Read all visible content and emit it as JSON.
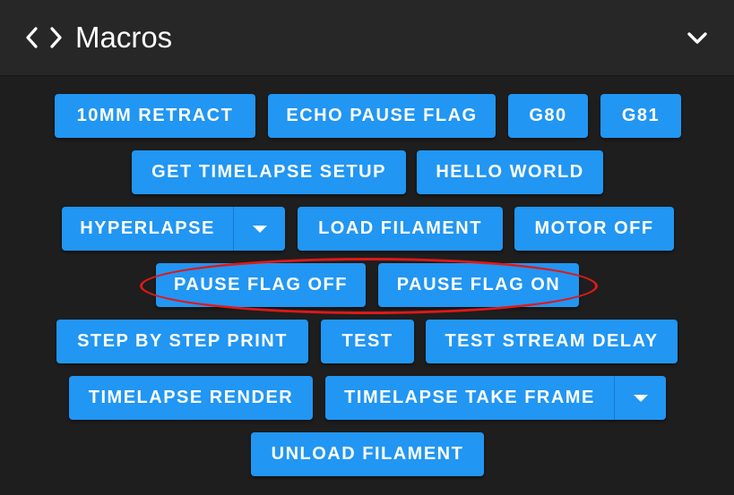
{
  "header": {
    "title": "Macros",
    "icon": "code-icon",
    "collapse_icon": "chevron-down-icon"
  },
  "colors": {
    "button": "#2196f3",
    "background": "#1e1e1e",
    "header": "#272727",
    "annotation": "#e01818"
  },
  "macros": {
    "retract_10mm": "10MM RETRACT",
    "echo_pause_flag": "ECHO PAUSE FLAG",
    "g80": "G80",
    "g81": "G81",
    "get_timelapse_setup": "GET TIMELAPSE SETUP",
    "hello_world": "HELLO WORLD",
    "hyperlapse": "HYPERLAPSE",
    "load_filament": "LOAD FILAMENT",
    "motor_off": "MOTOR OFF",
    "pause_flag_off": "PAUSE FLAG OFF",
    "pause_flag_on": "PAUSE FLAG ON",
    "step_by_step_print": "STEP BY STEP PRINT",
    "test": "TEST",
    "test_stream_delay": "TEST STREAM DELAY",
    "timelapse_render": "TIMELAPSE RENDER",
    "timelapse_take_frame": "TIMELAPSE TAKE FRAME",
    "unload_filament": "UNLOAD FILAMENT"
  }
}
